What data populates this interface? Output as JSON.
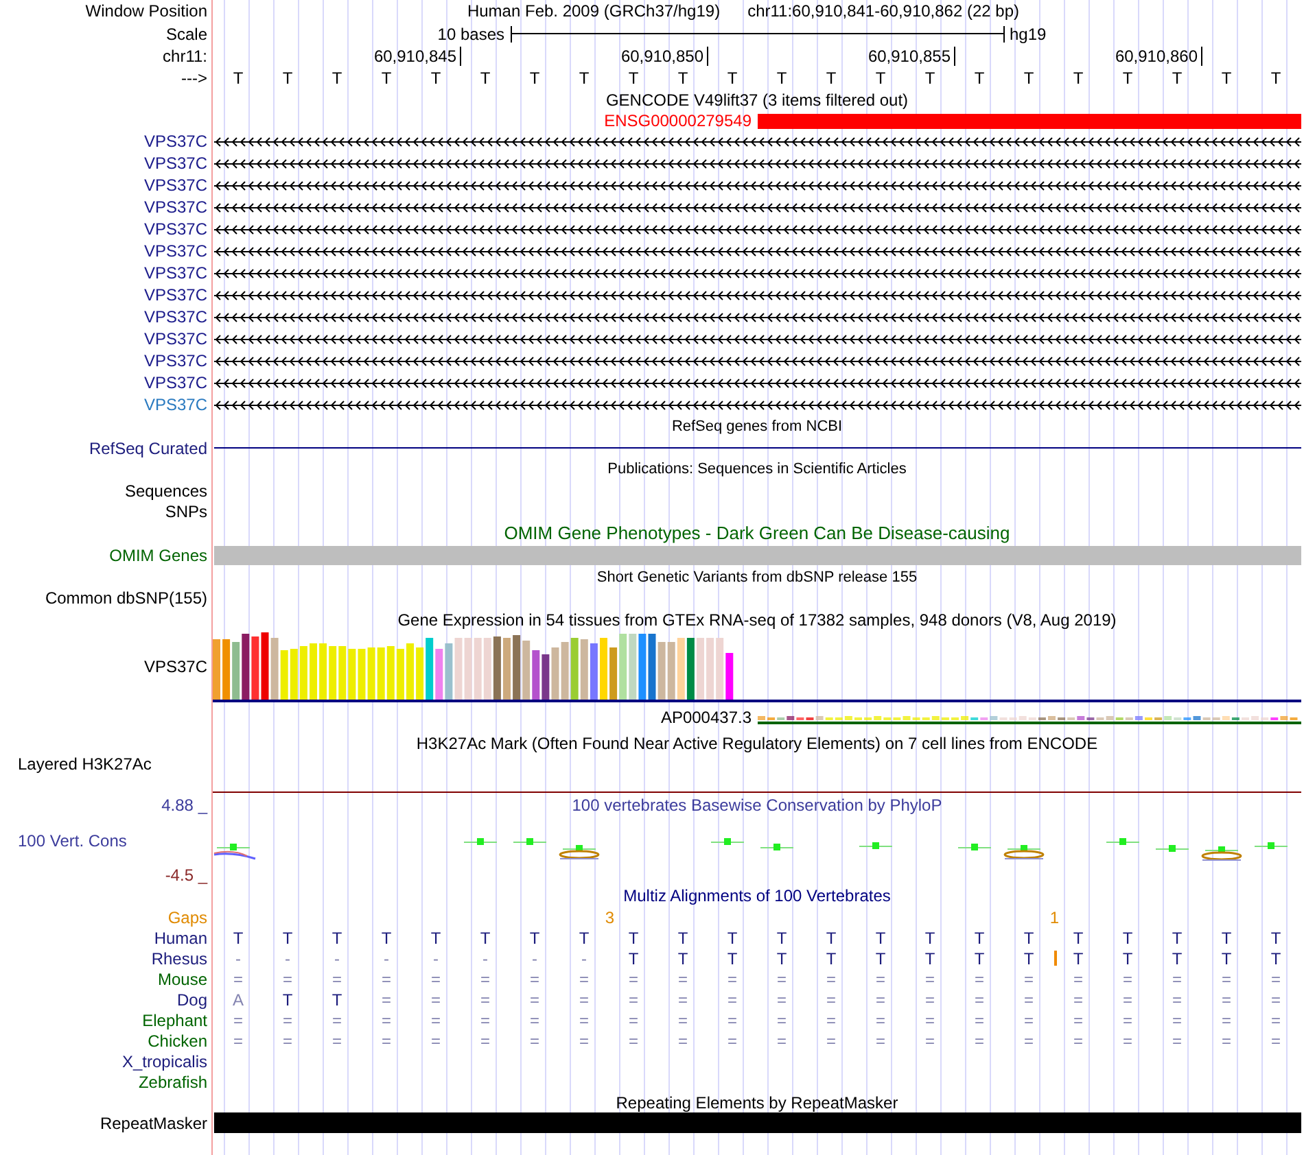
{
  "position": {
    "label": "Window Position",
    "assembly": "Human Feb. 2009 (GRCh37/hg19)",
    "range": "chr11:60,910,841-60,910,862 (22 bp)"
  },
  "scale": {
    "label": "Scale",
    "span": "10 bases",
    "db": "hg19"
  },
  "ruler": {
    "label": "chr11:",
    "ticks": [
      "60,910,845",
      "60,910,850",
      "60,910,855",
      "60,910,860"
    ]
  },
  "sequence": {
    "label": "--->",
    "bases": [
      "T",
      "T",
      "T",
      "T",
      "T",
      "T",
      "T",
      "T",
      "T",
      "T",
      "T",
      "T",
      "T",
      "T",
      "T",
      "T",
      "T",
      "T",
      "T",
      "T",
      "T",
      "T"
    ]
  },
  "tracks": [
    {
      "kind": "gencode",
      "title": "GENCODE V49lift37 (3 items filtered out)",
      "feature": "ENSG00000279549",
      "transcripts": [
        {
          "name": "VPS37C",
          "color": "#1c1c8c"
        },
        {
          "name": "VPS37C",
          "color": "#1c1c8c"
        },
        {
          "name": "VPS37C",
          "color": "#1c1c8c"
        },
        {
          "name": "VPS37C",
          "color": "#1c1c8c"
        },
        {
          "name": "VPS37C",
          "color": "#1c1c8c"
        },
        {
          "name": "VPS37C",
          "color": "#1c1c8c"
        },
        {
          "name": "VPS37C",
          "color": "#1c1c8c"
        },
        {
          "name": "VPS37C",
          "color": "#1c1c8c"
        },
        {
          "name": "VPS37C",
          "color": "#1c1c8c"
        },
        {
          "name": "VPS37C",
          "color": "#1c1c8c"
        },
        {
          "name": "VPS37C",
          "color": "#1c1c8c"
        },
        {
          "name": "VPS37C",
          "color": "#1c1c8c"
        },
        {
          "name": "VPS37C",
          "color": "#2a7ac0"
        }
      ]
    },
    {
      "kind": "refseq",
      "title": "RefSeq genes from NCBI",
      "label": "RefSeq Curated"
    },
    {
      "kind": "publications",
      "title": "Publications: Sequences in Scientific Articles",
      "labels": [
        "Sequences",
        "SNPs"
      ]
    },
    {
      "kind": "omim",
      "title": "OMIM Gene Phenotypes - Dark Green Can Be Disease-causing",
      "label": "OMIM Genes"
    },
    {
      "kind": "dbsnp",
      "title": "Short Genetic Variants from dbSNP release 155",
      "label": "Common dbSNP(155)"
    },
    {
      "kind": "gtex",
      "title": "Gene Expression in 54 tissues from GTEx RNA-seq of 17382 samples, 948 donors (V8, Aug 2019)",
      "label": "VPS37C",
      "gene": "AP000437.3"
    },
    {
      "kind": "h3k27ac",
      "title": "H3K27Ac Mark (Often Found Near Active Regulatory Elements) on 7 cell lines from ENCODE",
      "label": "Layered H3K27Ac"
    },
    {
      "kind": "phylop",
      "title": "100 vertebrates Basewise Conservation by PhyloP",
      "label": "100 Vert. Cons",
      "max": "4.88 _",
      "min": "-4.5 _"
    },
    {
      "kind": "multiz",
      "title": "Multiz Alignments of 100 Vertebrates",
      "gaps_label": "Gaps",
      "species": [
        {
          "name": "Human",
          "color": "#1c1c7c",
          "bases": [
            {
              "b": "T",
              "faint": false
            },
            {
              "b": "T",
              "faint": false
            },
            {
              "b": "T",
              "faint": false
            },
            {
              "b": "T",
              "faint": false
            },
            {
              "b": "T",
              "faint": false
            },
            {
              "b": "T",
              "faint": false
            },
            {
              "b": "T",
              "faint": false
            },
            {
              "b": "T",
              "faint": false,
              "gap": "3"
            },
            {
              "b": "T",
              "faint": false
            },
            {
              "b": "T",
              "faint": false
            },
            {
              "b": "T",
              "faint": false
            },
            {
              "b": "T",
              "faint": false
            },
            {
              "b": "T",
              "faint": false
            },
            {
              "b": "T",
              "faint": false
            },
            {
              "b": "T",
              "faint": false
            },
            {
              "b": "T",
              "faint": false
            },
            {
              "b": "T",
              "faint": false,
              "gap": "1"
            },
            {
              "b": "T",
              "faint": false
            },
            {
              "b": "T",
              "faint": false
            },
            {
              "b": "T",
              "faint": false
            },
            {
              "b": "T",
              "faint": false
            },
            {
              "b": "T",
              "faint": false
            }
          ]
        },
        {
          "name": "Rhesus",
          "color": "#1c1c7c",
          "bases": [
            {
              "b": "-",
              "faint": true,
              "insert": false
            },
            {
              "b": "-",
              "faint": true,
              "insert": false
            },
            {
              "b": "-",
              "faint": true,
              "insert": false
            },
            {
              "b": "-",
              "faint": true,
              "insert": false
            },
            {
              "b": "-",
              "faint": true,
              "insert": false
            },
            {
              "b": "-",
              "faint": true,
              "insert": false
            },
            {
              "b": "-",
              "faint": true,
              "insert": false
            },
            {
              "b": "-",
              "faint": true,
              "insert": false
            },
            {
              "b": "T",
              "faint": false,
              "insert": false
            },
            {
              "b": "T",
              "faint": false,
              "insert": false
            },
            {
              "b": "T",
              "faint": false,
              "insert": false
            },
            {
              "b": "T",
              "faint": false,
              "insert": false
            },
            {
              "b": "T",
              "faint": false,
              "insert": false
            },
            {
              "b": "T",
              "faint": false,
              "insert": false
            },
            {
              "b": "T",
              "faint": false,
              "insert": false
            },
            {
              "b": "T",
              "faint": false,
              "insert": false
            },
            {
              "b": "T",
              "faint": false,
              "insert": true
            },
            {
              "b": "T",
              "faint": false,
              "insert": false
            },
            {
              "b": "T",
              "faint": false,
              "insert": false
            },
            {
              "b": "T",
              "faint": false,
              "insert": false
            },
            {
              "b": "T",
              "faint": false,
              "insert": false
            },
            {
              "b": "T",
              "faint": false,
              "insert": false
            }
          ]
        },
        {
          "name": "Mouse",
          "color": "#006400",
          "bases": [
            {
              "b": "=",
              "faint": true
            },
            {
              "b": "=",
              "faint": true
            },
            {
              "b": "=",
              "faint": true
            },
            {
              "b": "=",
              "faint": true
            },
            {
              "b": "=",
              "faint": true
            },
            {
              "b": "=",
              "faint": true
            },
            {
              "b": "=",
              "faint": true
            },
            {
              "b": "=",
              "faint": true
            },
            {
              "b": "=",
              "faint": true
            },
            {
              "b": "=",
              "faint": true
            },
            {
              "b": "=",
              "faint": true
            },
            {
              "b": "=",
              "faint": true
            },
            {
              "b": "=",
              "faint": true
            },
            {
              "b": "=",
              "faint": true
            },
            {
              "b": "=",
              "faint": true
            },
            {
              "b": "=",
              "faint": true
            },
            {
              "b": "=",
              "faint": true
            },
            {
              "b": "=",
              "faint": true
            },
            {
              "b": "=",
              "faint": true
            },
            {
              "b": "=",
              "faint": true
            },
            {
              "b": "=",
              "faint": true
            },
            {
              "b": "=",
              "faint": true
            }
          ]
        },
        {
          "name": "Dog",
          "color": "#1c1c7c",
          "bases": [
            {
              "b": "A",
              "faint": true
            },
            {
              "b": "T",
              "faint": false
            },
            {
              "b": "T",
              "faint": false
            },
            {
              "b": "=",
              "faint": true
            },
            {
              "b": "=",
              "faint": true
            },
            {
              "b": "=",
              "faint": true
            },
            {
              "b": "=",
              "faint": true
            },
            {
              "b": "=",
              "faint": true
            },
            {
              "b": "=",
              "faint": true
            },
            {
              "b": "=",
              "faint": true
            },
            {
              "b": "=",
              "faint": true
            },
            {
              "b": "=",
              "faint": true
            },
            {
              "b": "=",
              "faint": true
            },
            {
              "b": "=",
              "faint": true
            },
            {
              "b": "=",
              "faint": true
            },
            {
              "b": "=",
              "faint": true
            },
            {
              "b": "=",
              "faint": true
            },
            {
              "b": "=",
              "faint": true
            },
            {
              "b": "=",
              "faint": true
            },
            {
              "b": "=",
              "faint": true
            },
            {
              "b": "=",
              "faint": true
            },
            {
              "b": "=",
              "faint": true
            }
          ]
        },
        {
          "name": "Elephant",
          "color": "#006400",
          "bases": [
            {
              "b": "=",
              "faint": true
            },
            {
              "b": "=",
              "faint": true
            },
            {
              "b": "=",
              "faint": true
            },
            {
              "b": "=",
              "faint": true
            },
            {
              "b": "=",
              "faint": true
            },
            {
              "b": "=",
              "faint": true
            },
            {
              "b": "=",
              "faint": true
            },
            {
              "b": "=",
              "faint": true
            },
            {
              "b": "=",
              "faint": true
            },
            {
              "b": "=",
              "faint": true
            },
            {
              "b": "=",
              "faint": true
            },
            {
              "b": "=",
              "faint": true
            },
            {
              "b": "=",
              "faint": true
            },
            {
              "b": "=",
              "faint": true
            },
            {
              "b": "=",
              "faint": true
            },
            {
              "b": "=",
              "faint": true
            },
            {
              "b": "=",
              "faint": true
            },
            {
              "b": "=",
              "faint": true
            },
            {
              "b": "=",
              "faint": true
            },
            {
              "b": "=",
              "faint": true
            },
            {
              "b": "=",
              "faint": true
            },
            {
              "b": "=",
              "faint": true
            }
          ]
        },
        {
          "name": "Chicken",
          "color": "#006400",
          "bases": [
            {
              "b": "=",
              "faint": true
            },
            {
              "b": "=",
              "faint": true
            },
            {
              "b": "=",
              "faint": true
            },
            {
              "b": "=",
              "faint": true
            },
            {
              "b": "=",
              "faint": true
            },
            {
              "b": "=",
              "faint": true
            },
            {
              "b": "=",
              "faint": true
            },
            {
              "b": "=",
              "faint": true
            },
            {
              "b": "=",
              "faint": true
            },
            {
              "b": "=",
              "faint": true
            },
            {
              "b": "=",
              "faint": true
            },
            {
              "b": "=",
              "faint": true
            },
            {
              "b": "=",
              "faint": true
            },
            {
              "b": "=",
              "faint": true
            },
            {
              "b": "=",
              "faint": true
            },
            {
              "b": "=",
              "faint": true
            },
            {
              "b": "=",
              "faint": true
            },
            {
              "b": "=",
              "faint": true
            },
            {
              "b": "=",
              "faint": true
            },
            {
              "b": "=",
              "faint": true
            },
            {
              "b": "=",
              "faint": true
            },
            {
              "b": "=",
              "faint": true
            }
          ]
        },
        {
          "name": "X_tropicalis",
          "color": "#1c1c7c"
        },
        {
          "name": "Zebrafish",
          "color": "#006400"
        }
      ]
    },
    {
      "kind": "repeatmasker",
      "title": "Repeating Elements by RepeatMasker",
      "label": "RepeatMasker"
    }
  ]
}
